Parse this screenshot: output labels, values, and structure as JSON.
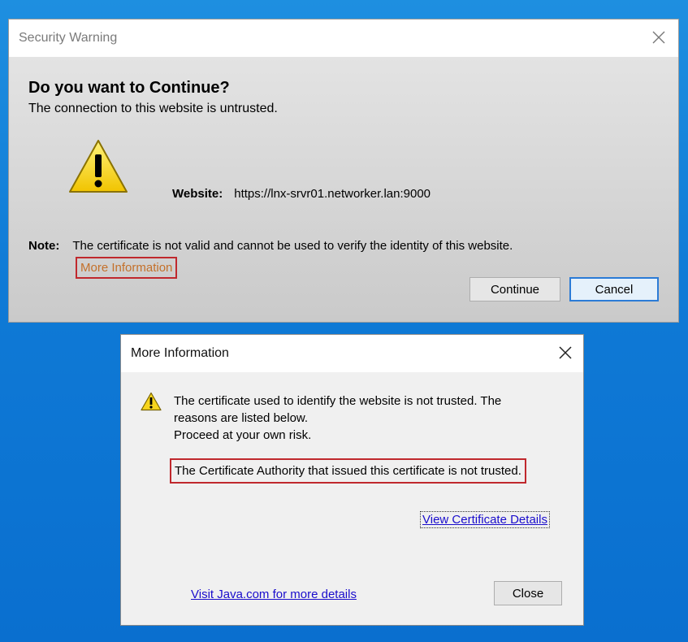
{
  "security_warning": {
    "title": "Security Warning",
    "heading": "Do you want to Continue?",
    "subheading": "The connection to this website is untrusted.",
    "website_label": "Website:",
    "website_value": "https://lnx-srvr01.networker.lan:9000",
    "note_label": "Note:",
    "note_text": "The certificate is not valid and cannot be used to verify the identity of this website.",
    "more_info_link": "More Information",
    "continue_label": "Continue",
    "cancel_label": "Cancel"
  },
  "more_information": {
    "title": "More Information",
    "message_line1": "The certificate used to identify the website is not trusted.  The",
    "message_line2": "reasons are listed below.",
    "message_line3": "Proceed at your own risk.",
    "reason": "The Certificate Authority that issued this certificate is not trusted.",
    "view_cert_link": "View Certificate Details",
    "visit_link": "Visit Java.com for more details",
    "close_label": "Close"
  },
  "colors": {
    "desktop": "#0f7ad6",
    "highlight_border": "#c0282d",
    "link": "#1a0dcc",
    "warning_yellow": "#f7d51d"
  },
  "icons": {
    "window_close": "close-icon",
    "warning": "warning-icon"
  }
}
